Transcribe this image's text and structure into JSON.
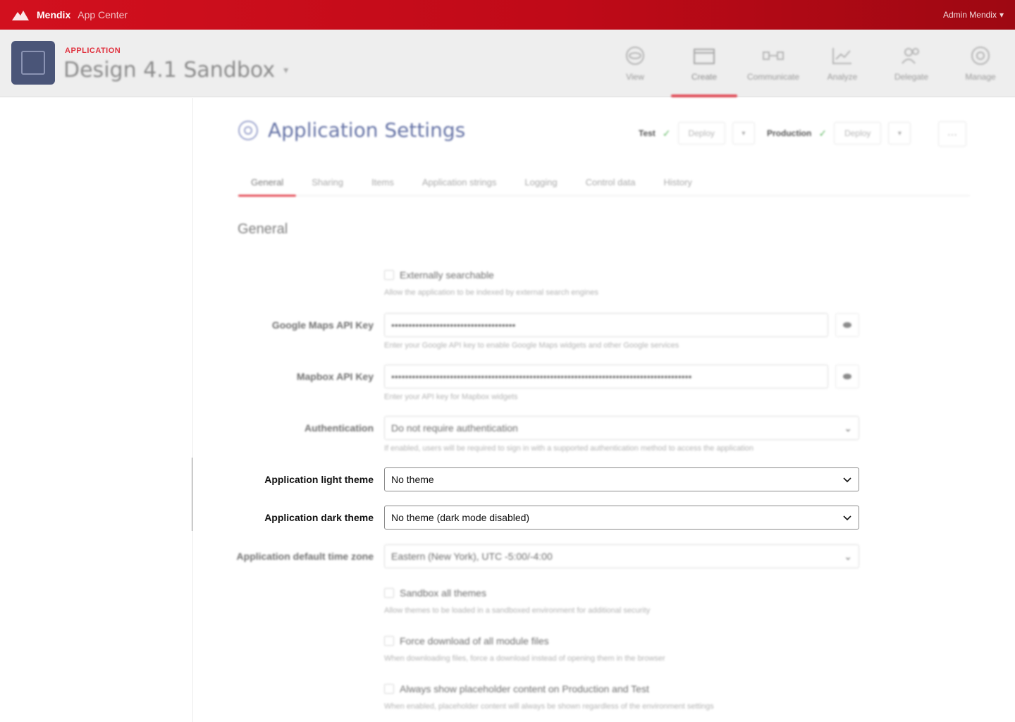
{
  "topbar": {
    "brand_name": "Mendix",
    "brand_sub": "App Center",
    "user": "Admin Mendix"
  },
  "app": {
    "label": "APPLICATION",
    "title": "Design 4.1 Sandbox"
  },
  "nav": [
    {
      "label": "View",
      "icon": "eye-icon"
    },
    {
      "label": "Create",
      "icon": "window-icon",
      "active": true
    },
    {
      "label": "Communicate",
      "icon": "flow-icon"
    },
    {
      "label": "Analyze",
      "icon": "chart-icon"
    },
    {
      "label": "Delegate",
      "icon": "users-icon"
    },
    {
      "label": "Manage",
      "icon": "gear-icon"
    }
  ],
  "page": {
    "title": "Application Settings",
    "test_env": "Test",
    "production_env": "Production",
    "deploy_label": "Deploy",
    "more_label": "···"
  },
  "tabs": [
    "General",
    "Sharing",
    "Items",
    "Application strings",
    "Logging",
    "Control data",
    "History"
  ],
  "section_title": "General",
  "form": {
    "externally_searchable": {
      "label": "Externally searchable",
      "help": "Allow the application to be indexed by external search engines"
    },
    "google_maps_key": {
      "label": "Google Maps API Key",
      "value": "••••••••••••••••••••••••••••••••••••",
      "help": "Enter your Google API key to enable Google Maps widgets and other Google services"
    },
    "mapbox_key": {
      "label": "Mapbox API Key",
      "value": "•••••••••••••••••••••••••••••••••••••••••••••••••••••••••••••••••••••••••••••••••••••••",
      "help": "Enter your API key for Mapbox widgets"
    },
    "authentication": {
      "label": "Authentication",
      "value": "Do not require authentication",
      "help": "If enabled, users will be required to sign in with a supported authentication method to access the application"
    },
    "light_theme": {
      "label": "Application light theme",
      "value": "No theme"
    },
    "dark_theme": {
      "label": "Application dark theme",
      "value": "No theme (dark mode disabled)"
    },
    "time_zone": {
      "label": "Application default time zone",
      "value": "Eastern (New York), UTC -5:00/-4:00"
    },
    "sandbox_themes": {
      "label": "Sandbox all themes",
      "help": "Allow themes to be loaded in a sandboxed environment for additional security"
    },
    "force_download": {
      "label": "Force download of all module files",
      "help": "When downloading files, force a download instead of opening them in the browser"
    },
    "placeholder_content": {
      "label": "Always show placeholder content on Production and Test",
      "help": "When enabled, placeholder content will always be shown regardless of the environment settings"
    }
  }
}
